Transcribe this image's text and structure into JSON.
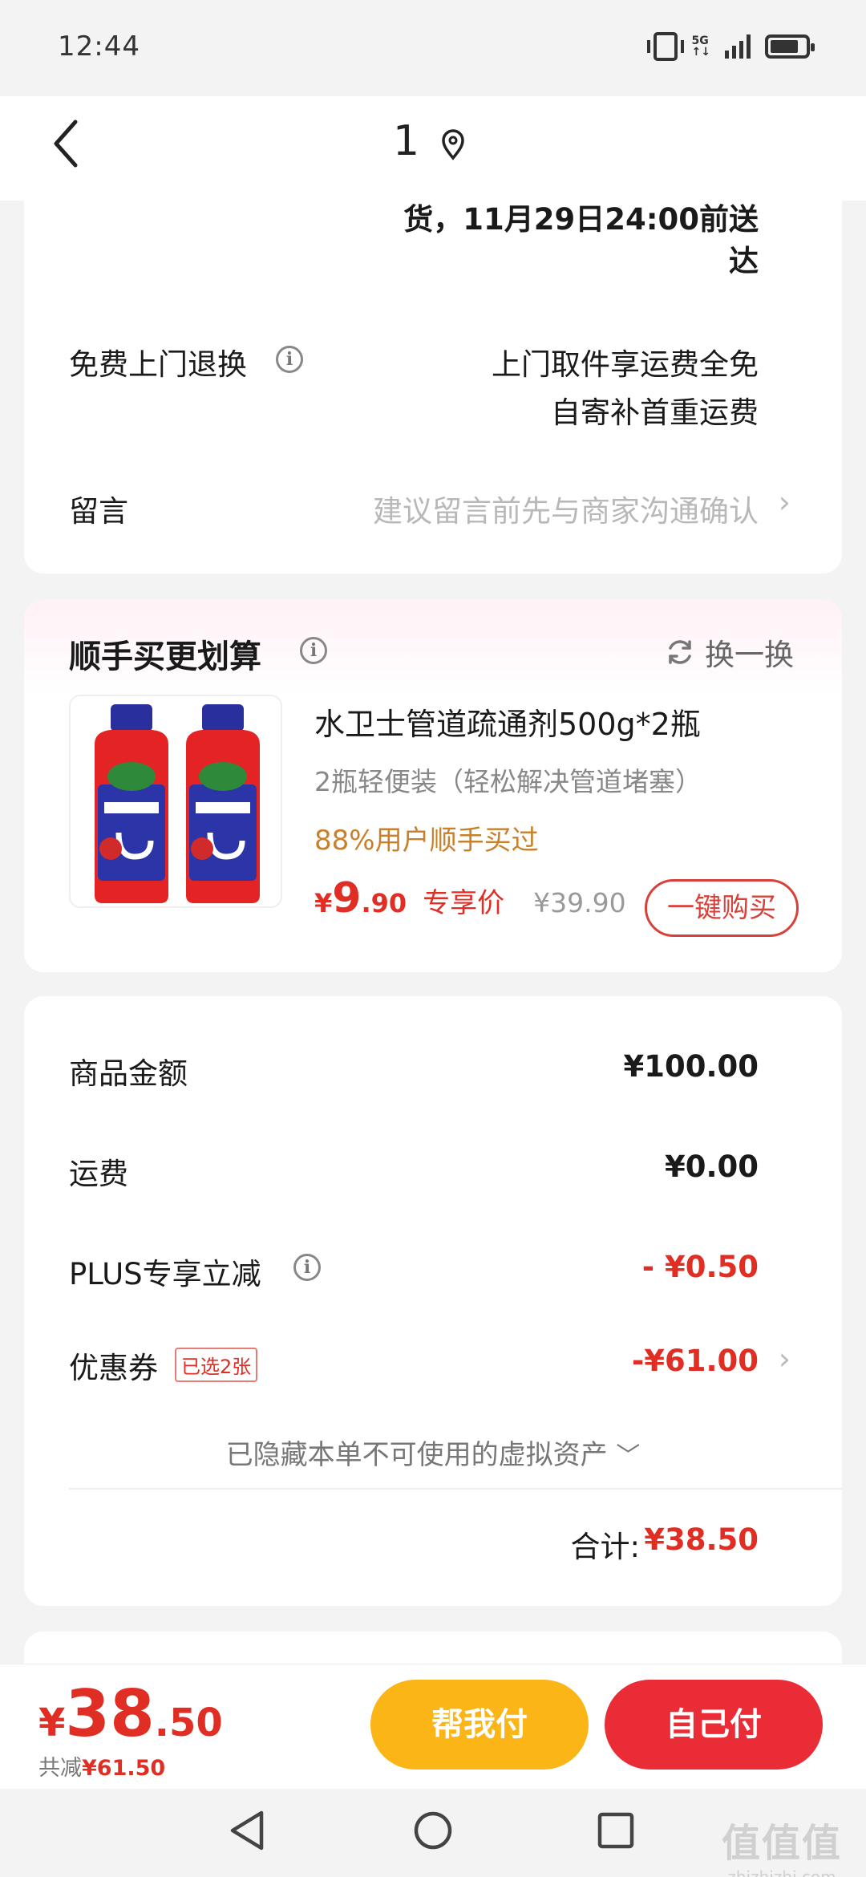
{
  "status_bar": {
    "time": "12:44",
    "network": "5G"
  },
  "header": {
    "title": "1"
  },
  "delivery": {
    "line1": "货，11月29日24:00前送",
    "line2": "达"
  },
  "return_service": {
    "label": "免费上门退换",
    "line1": "上门取件享运费全免",
    "line2": "自寄补首重运费"
  },
  "message": {
    "label": "留言",
    "placeholder": "建议留言前先与商家沟通确认"
  },
  "addon": {
    "title": "顺手买更划算",
    "swap_label": "换一换",
    "product_name": "水卫士管道疏通剂500g*2瓶",
    "product_sub": "2瓶轻便装（轻松解决管道堵塞）",
    "users_bought": "88%用户顺手买过",
    "price_yen": "¥",
    "price_int": "9",
    "price_dec": ".90",
    "price_tag": "专享价",
    "orig_price": "¥39.90",
    "buy_button": "一键购买",
    "image_logo": "水卫士"
  },
  "totals": {
    "goods_label": "商品金额",
    "goods_value": "¥100.00",
    "shipping_label": "运费",
    "shipping_value": "¥0.00",
    "plus_label": "PLUS专享立减",
    "plus_value": "- ¥0.50",
    "coupon_label": "优惠券",
    "coupon_badge": "已选2张",
    "coupon_value": "-¥61.00",
    "hidden_assets": "已隐藏本单不可使用的虚拟资产",
    "sum_label": "合计:",
    "sum_value": "¥38.50"
  },
  "bottom_bar": {
    "pay_yen": "¥",
    "pay_int": "38",
    "pay_dec": ".50",
    "saved_label": "共减",
    "saved_value": "¥61.50",
    "help_pay": "帮我付",
    "self_pay": "自己付"
  },
  "watermark": {
    "big": "值值值",
    "small": "zhizhizhi.com"
  },
  "colors": {
    "accent_red": "#e02e24",
    "accent_yellow": "#fbb516",
    "button_red": "#ea2c36"
  }
}
